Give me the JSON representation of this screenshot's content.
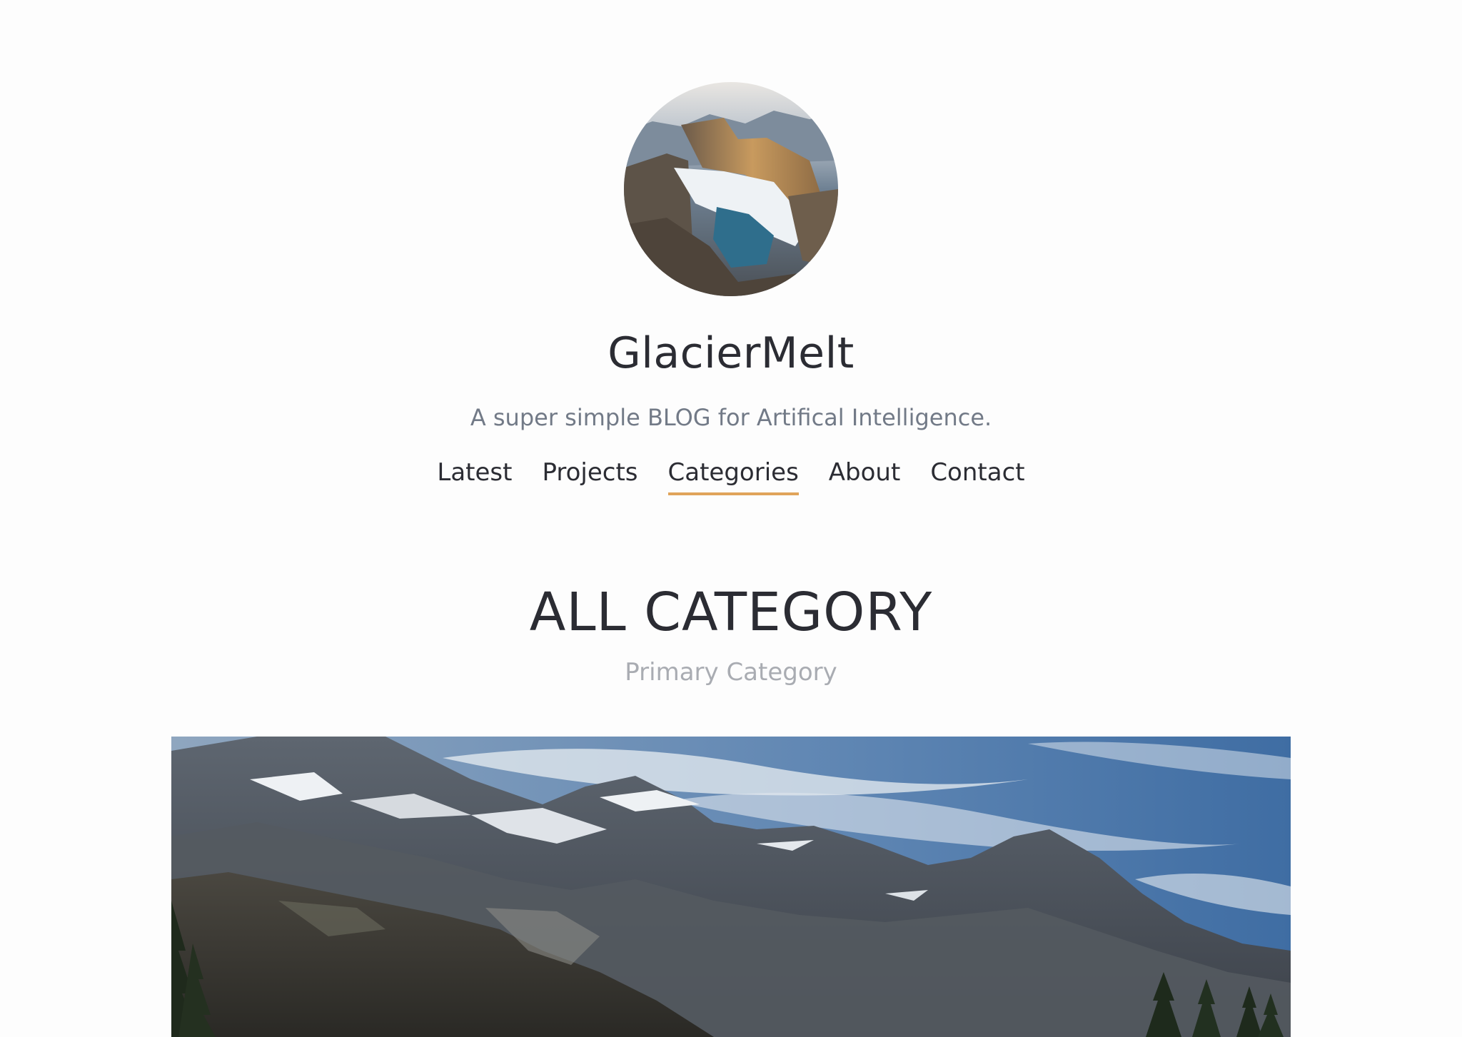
{
  "site": {
    "title": "GlacierMelt",
    "tagline": "A super simple BLOG for Artifical Intelligence."
  },
  "nav": {
    "items": [
      {
        "label": "Latest"
      },
      {
        "label": "Projects"
      },
      {
        "label": "Categories"
      },
      {
        "label": "About"
      },
      {
        "label": "Contact"
      }
    ],
    "active": "Categories"
  },
  "main": {
    "heading": "ALL CATEGORY",
    "subheading": "Primary Category"
  },
  "colors": {
    "accent": "#e0a45a",
    "text": "#2b2c33",
    "muted": "#727a87",
    "subtle": "#a9acb2"
  }
}
